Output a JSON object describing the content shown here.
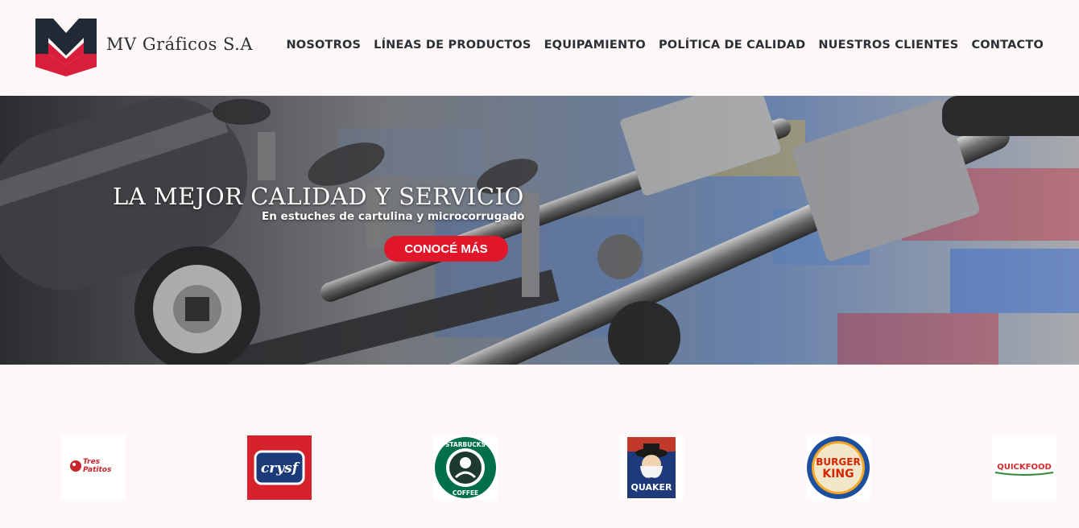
{
  "brand": {
    "name": "MV Gráficos S.A",
    "logo": "mv-logo",
    "colors": {
      "dark": "#1f2a35",
      "red": "#d81e3a"
    }
  },
  "nav": [
    {
      "label": "NOSOTROS"
    },
    {
      "label": "LÍNEAS DE PRODUCTOS"
    },
    {
      "label": "EQUIPAMIENTO"
    },
    {
      "label": "POLÍTICA DE CALIDAD"
    },
    {
      "label": "NUESTROS CLIENTES"
    },
    {
      "label": "CONTACTO"
    }
  ],
  "hero": {
    "title": "LA MEJOR CALIDAD Y SERVICIO",
    "subtitle": "En estuches de cartulina y microcorrugado",
    "cta": "CONOCÉ MÁS",
    "cta_color": "#e0162b"
  },
  "clients": [
    {
      "name": "Tres Patitos",
      "logo_text": "Tres Patitos"
    },
    {
      "name": "Crysf",
      "logo_text": "Crysf"
    },
    {
      "name": "Starbucks Coffee",
      "logo_text": "STARBUCKS COFFEE"
    },
    {
      "name": "Quaker",
      "logo_text": "QUAKER"
    },
    {
      "name": "Burger King",
      "logo_text": "BURGER KING"
    },
    {
      "name": "Quickfood",
      "logo_text": "QUICKFOOD"
    }
  ]
}
